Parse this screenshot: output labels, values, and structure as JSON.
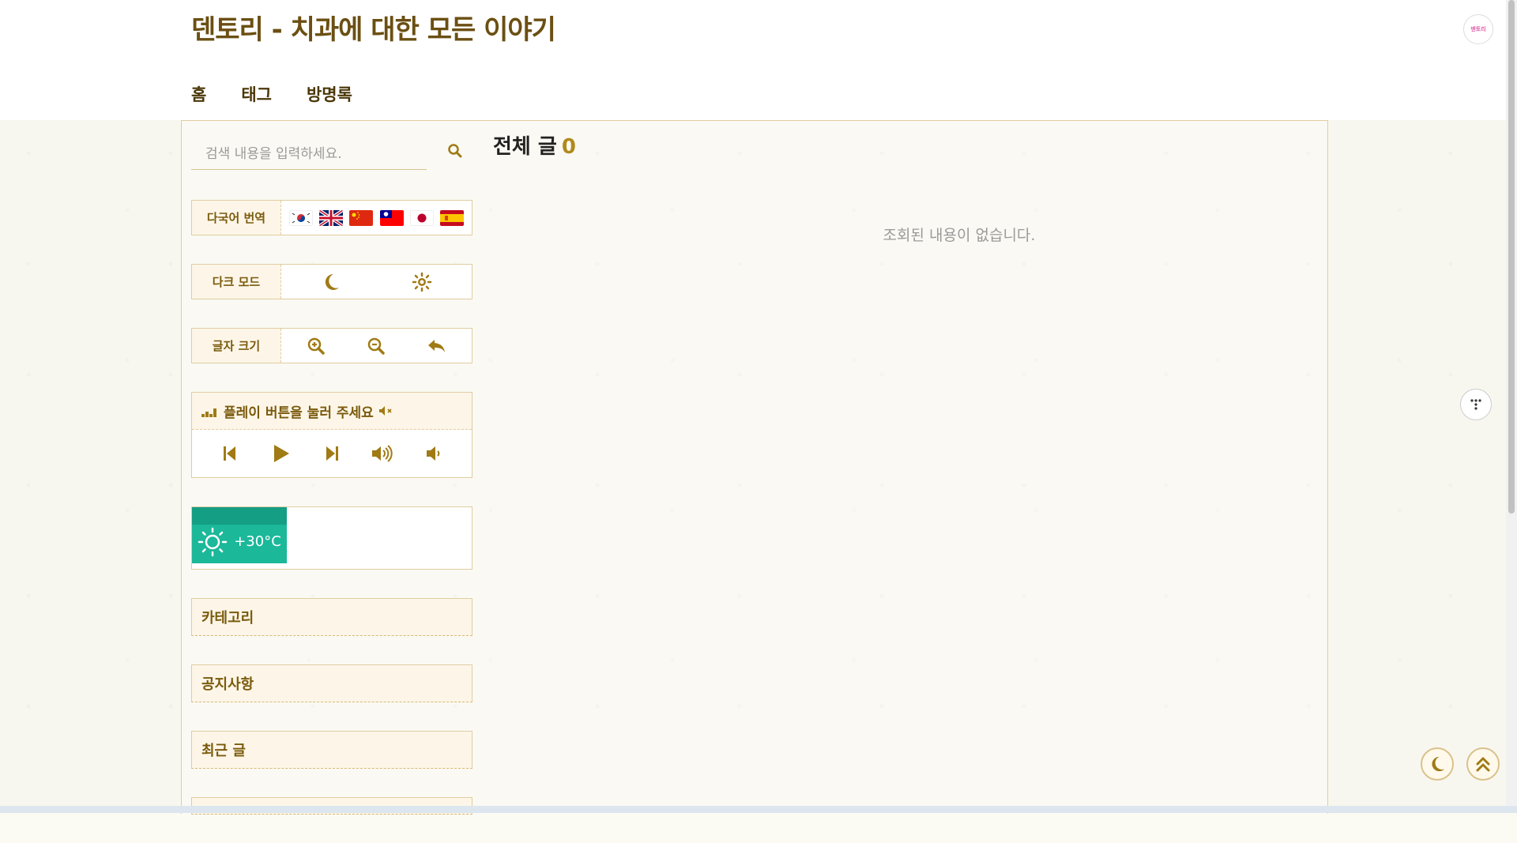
{
  "header": {
    "site_title": "덴토리 - 치과에 대한 모든 이야기",
    "avatar_text": "덴토리"
  },
  "nav": {
    "items": [
      {
        "label": "홈"
      },
      {
        "label": "태그"
      },
      {
        "label": "방명록"
      }
    ]
  },
  "search": {
    "placeholder": "검색 내용을 입력하세요.",
    "value": ""
  },
  "translate": {
    "label": "다국어 번역",
    "languages": [
      "korean",
      "english",
      "chinese-simplified",
      "chinese-traditional",
      "japanese",
      "spanish"
    ]
  },
  "dark_mode": {
    "label": "다크 모드"
  },
  "font_size": {
    "label": "글자 크기"
  },
  "player": {
    "status": "플레이 버튼을 눌러 주세요"
  },
  "weather": {
    "temperature": "+30°C"
  },
  "sidebar_boxes": {
    "category": "카테고리",
    "notice": "공지사항",
    "recent": "최근 글"
  },
  "main": {
    "heading": "전체 글",
    "count": "0",
    "empty_message": "조회된 내용이 없습니다."
  },
  "colors": {
    "accent": "#b08a1c",
    "brand_brown": "#6b4f12",
    "weather_green": "#1bb89a"
  }
}
